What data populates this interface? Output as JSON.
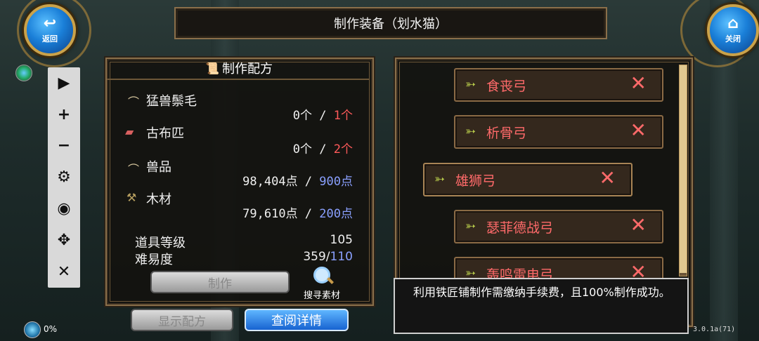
{
  "nav": {
    "back_label": "返回",
    "close_label": "关闭"
  },
  "title": "制作装备（划水猫）",
  "recipe_panel": {
    "heading": "制作配方",
    "materials": [
      {
        "name": "猛兽鬃毛",
        "have": "0个",
        "sep": " / ",
        "need": "1个",
        "need_color": "red",
        "icon": "fang-icon"
      },
      {
        "name": "古布匹",
        "have": "0个",
        "sep": " / ",
        "need": "2个",
        "need_color": "red",
        "icon": "cloth-icon"
      },
      {
        "name": "兽品",
        "have": "98,404点",
        "sep": " / ",
        "need": "900点",
        "need_color": "blue",
        "icon": "claw-icon"
      },
      {
        "name": "木材",
        "have": "79,610点",
        "sep": " / ",
        "need": "200点",
        "need_color": "blue",
        "icon": "wood-icon"
      }
    ],
    "item_level_label": "道具等级",
    "item_level_value": "105",
    "difficulty_label": "难易度",
    "difficulty_have": "359/",
    "difficulty_need": "110",
    "craft_button": "制作",
    "search_label": "搜寻素材"
  },
  "bottom_buttons": {
    "show_recipe": "显示配方",
    "view_details": "查阅详情"
  },
  "recipe_list": [
    {
      "name": "食丧弓"
    },
    {
      "name": "析骨弓"
    },
    {
      "name": "雄狮弓"
    },
    {
      "name": "瑟菲德战弓"
    },
    {
      "name": "轰鸣雷电弓"
    }
  ],
  "tooltip": "利用铁匠铺制作需缴纳手续费，且100%制作成功。",
  "status": {
    "percent": "0%",
    "version": "3.0.1a(71)"
  },
  "colors": {
    "red": "#ff5a5a",
    "blue": "#8aa0ff",
    "frame": "#8a6f4a",
    "accent_blue": "#1763d1"
  }
}
